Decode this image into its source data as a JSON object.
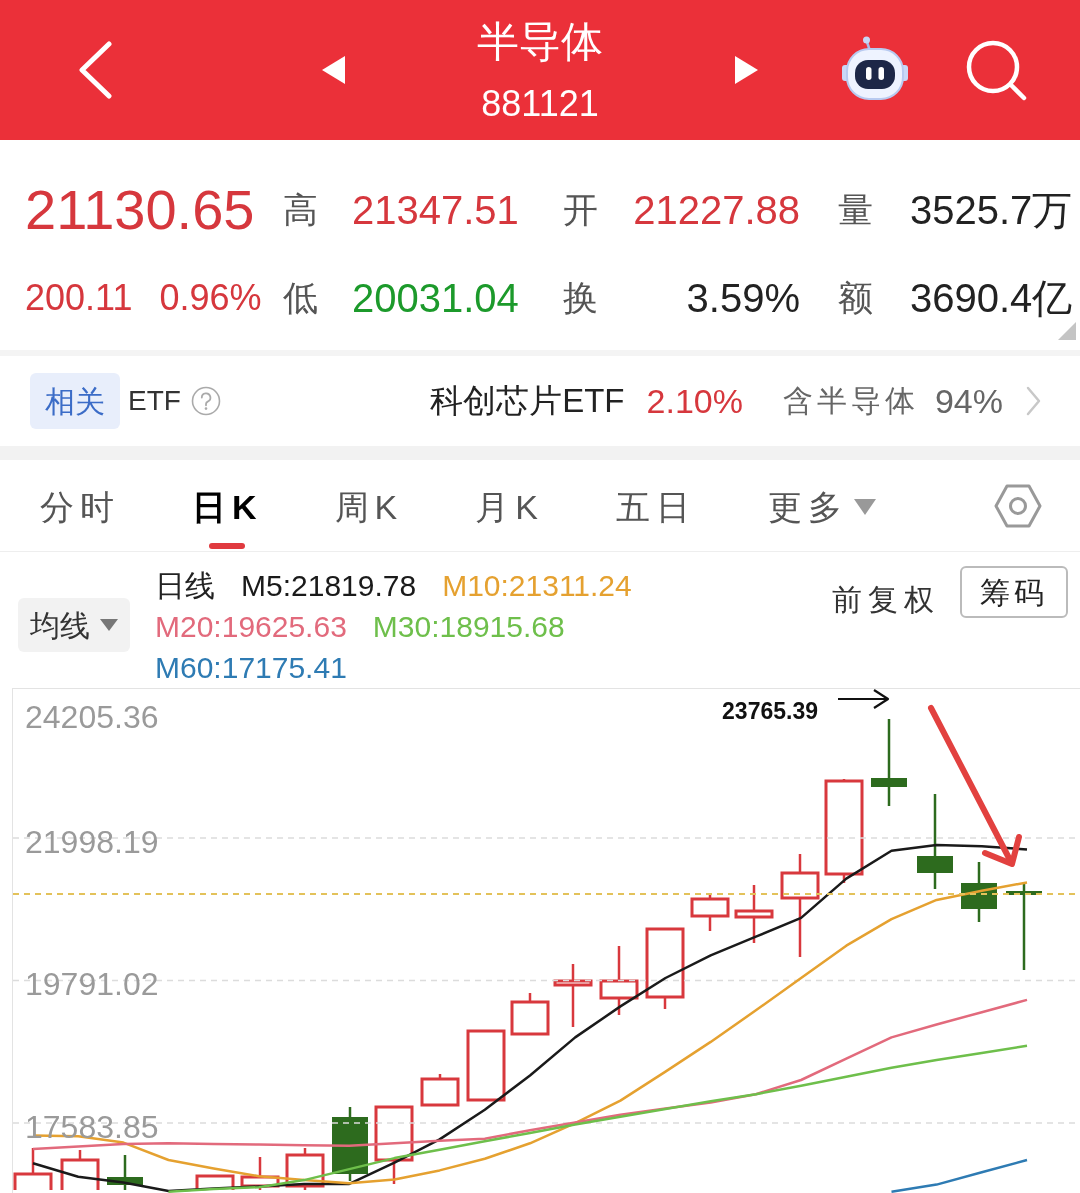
{
  "header": {
    "title": "半导体",
    "code": "881121"
  },
  "quote": {
    "price": "21130.65",
    "change": "200.11",
    "change_percent": "0.96%",
    "stats": [
      {
        "label": "高",
        "value": "21347.51",
        "color": "#d6373d"
      },
      {
        "label": "开",
        "value": "21227.88",
        "color": "#d6373d"
      },
      {
        "label": "量",
        "value": "3525.7万",
        "color": "#222222"
      },
      {
        "label": "低",
        "value": "20031.04",
        "color": "#1c9a2b"
      },
      {
        "label": "换",
        "value": "3.59%",
        "color": "#222222"
      },
      {
        "label": "额",
        "value": "3690.4亿",
        "color": "#222222"
      }
    ]
  },
  "related_etf": {
    "tag": "相关",
    "label": "ETF",
    "fund": "科创芯片ETF",
    "fund_change": "2.10%",
    "holding_label": "含半导体",
    "holding_share": "94%"
  },
  "tabs": [
    {
      "label": "分时",
      "selected": false,
      "kind": "tab"
    },
    {
      "label": "日K",
      "selected": true,
      "kind": "tab"
    },
    {
      "label": "周K",
      "selected": false,
      "kind": "tab"
    },
    {
      "label": "月K",
      "selected": false,
      "kind": "tab"
    },
    {
      "label": "五日",
      "selected": false,
      "kind": "tab"
    },
    {
      "label": "更多",
      "selected": false,
      "kind": "menu"
    }
  ],
  "chart_toolbar": {
    "indicator": "均线",
    "legend_title": "日线",
    "averages": [
      {
        "text": "M5:21819.78",
        "color": "#1a1a1a"
      },
      {
        "text": "M10:21311.24",
        "color": "#e5a130"
      },
      {
        "text": "M20:19625.63",
        "color": "#e26a7c"
      },
      {
        "text": "M30:18915.68",
        "color": "#6ebf4b"
      },
      {
        "text": "M60:17175.41",
        "color": "#2e7bb3"
      }
    ],
    "adjust": "前复权",
    "chips_button": "筹码"
  },
  "chart": {
    "chart_data": {
      "type": "line",
      "grid": true,
      "categories": [
        null,
        null,
        null,
        null,
        null,
        null,
        null,
        null,
        null,
        null,
        null,
        null,
        null,
        null,
        null,
        null,
        null,
        null,
        null,
        null,
        null,
        null,
        null
      ],
      "ylim": [
        16499.5,
        24306.0
      ],
      "yticks": [
        {
          "value": 24205.36,
          "label": "24205.36"
        },
        {
          "value": 21998.19,
          "label": "21998.19"
        },
        {
          "value": 19791.02,
          "label": "19791.02"
        },
        {
          "value": 17583.85,
          "label": "17583.85"
        }
      ],
      "series": [
        {
          "color": "#1a1a1a",
          "values": [
            16960,
            16750,
            16660,
            16530,
            16570,
            16600,
            16640,
            16640,
            16970,
            17330,
            17790,
            18320,
            18910,
            19390,
            19830,
            20180,
            20470,
            20760,
            21370,
            21800,
            21890,
            21870,
            21820
          ]
        },
        {
          "color": "#e5a130",
          "values": [
            17390,
            17380,
            17280,
            17010,
            16880,
            16760,
            16700,
            16650,
            16710,
            16850,
            17030,
            17270,
            17580,
            17930,
            18380,
            18840,
            19330,
            19830,
            20330,
            20740,
            21040,
            21180,
            21310
          ]
        },
        {
          "color": "#e26a7c",
          "values": [
            17180,
            17220,
            17260,
            17270,
            17260,
            17250,
            17240,
            17230,
            17270,
            17310,
            17340,
            17470,
            17590,
            17710,
            17810,
            17900,
            18030,
            18250,
            18580,
            18910,
            19110,
            19300,
            19490
          ]
        },
        {
          "color": "#6ebf4b",
          "values": [
            null,
            null,
            null,
            16520,
            16560,
            16590,
            16700,
            16870,
            17040,
            17170,
            17300,
            17430,
            17560,
            17680,
            17800,
            17920,
            18030,
            18160,
            18300,
            18440,
            18560,
            18670,
            18780
          ]
        },
        {
          "color": "#2e7bb3",
          "values": [
            null,
            null,
            null,
            null,
            null,
            null,
            null,
            null,
            null,
            null,
            null,
            null,
            null,
            null,
            null,
            null,
            null,
            null,
            null,
            16520,
            16630,
            16820,
            17010
          ]
        }
      ],
      "ref_lines": [
        {
          "axis": "y",
          "value": 21130.65,
          "color": "#e3c25a"
        }
      ],
      "annotations": [
        {
          "text": "23765.39"
        }
      ]
    }
  }
}
